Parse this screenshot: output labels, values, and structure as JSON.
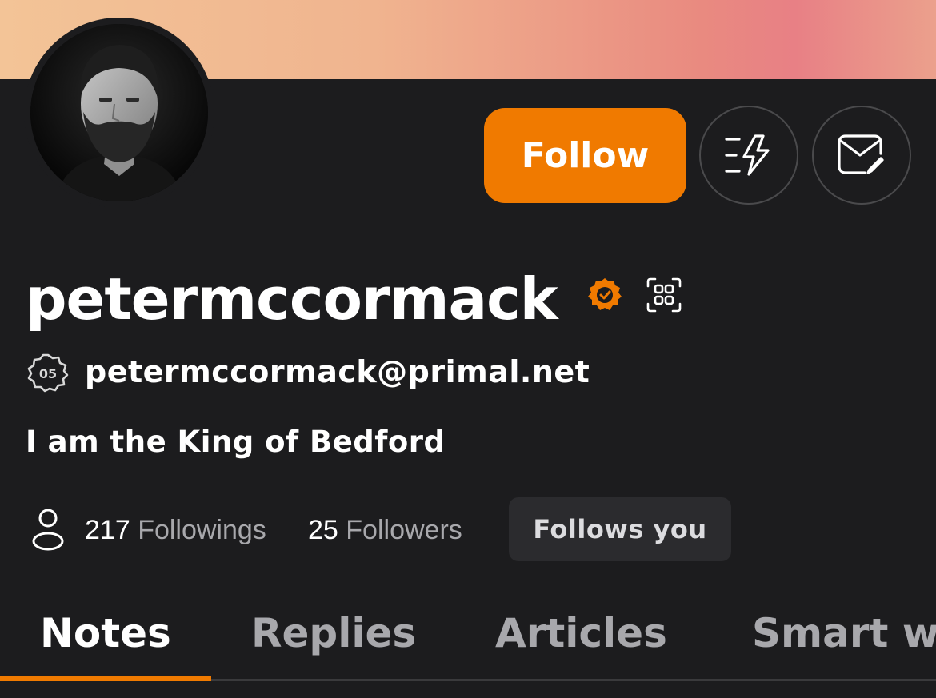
{
  "colors": {
    "accent": "#f07a00",
    "background": "#1c1c1e",
    "banner_gradient": [
      "#f3c497",
      "#e88085"
    ],
    "muted_text": "#a8a8ac"
  },
  "header": {
    "follow_label": "Follow",
    "zap_icon": "zap-icon",
    "message_icon": "message-icon"
  },
  "profile": {
    "username": "petermccormack",
    "verified_icon": "verified-badge-icon",
    "qr_icon": "qr-code-icon",
    "nip05_badge": "05",
    "nip05": "petermccormack@primal.net",
    "bio": "I am the King of Bedford"
  },
  "stats": {
    "followings_count": "217",
    "followings_label": "Followings",
    "followers_count": "25",
    "followers_label": "Followers",
    "follows_you": "Follows you"
  },
  "tabs": [
    {
      "label": "Notes",
      "active": true
    },
    {
      "label": "Replies",
      "active": false
    },
    {
      "label": "Articles",
      "active": false
    },
    {
      "label": "Smart w",
      "active": false
    }
  ]
}
